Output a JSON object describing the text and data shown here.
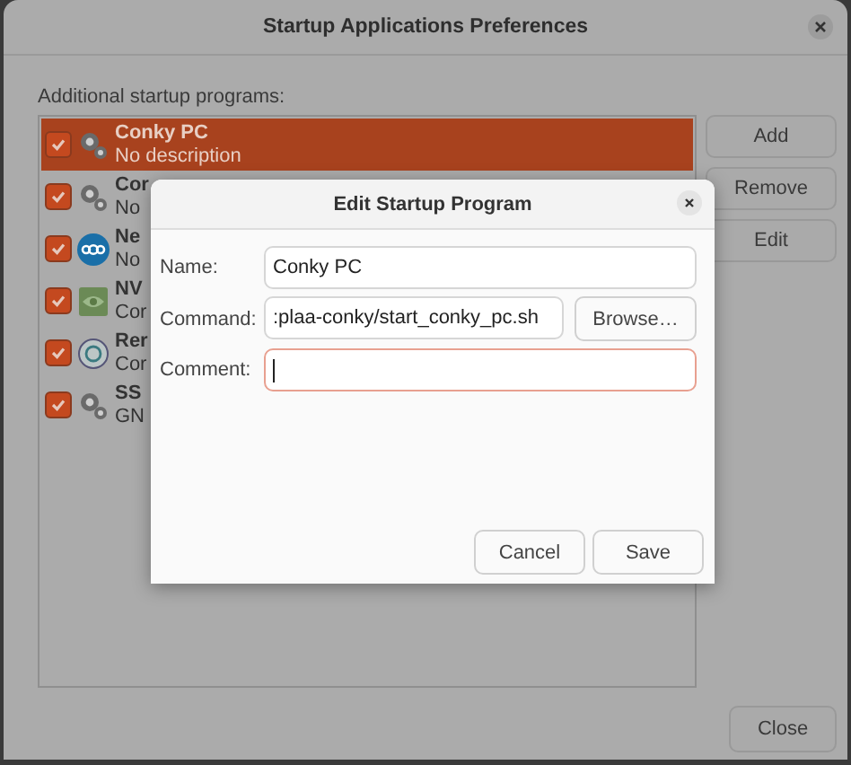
{
  "window": {
    "title": "Startup Applications Preferences"
  },
  "list_label": "Additional startup programs:",
  "programs": [
    {
      "name": "Conky PC",
      "description": "No description",
      "checked": true,
      "selected": true,
      "kind": "gears"
    },
    {
      "name": "Cor",
      "description": "No",
      "checked": true,
      "selected": false,
      "kind": "gears"
    },
    {
      "name": "Ne",
      "description": "No",
      "checked": true,
      "selected": false,
      "kind": "cloud"
    },
    {
      "name": "NV",
      "description": "Cor",
      "checked": true,
      "selected": false,
      "kind": "chip"
    },
    {
      "name": "Rer",
      "description": "Cor",
      "checked": true,
      "selected": false,
      "kind": "ring"
    },
    {
      "name": "SS",
      "description": "GN",
      "checked": true,
      "selected": false,
      "kind": "gears"
    }
  ],
  "side_buttons": [
    "Add",
    "Remove",
    "Edit"
  ],
  "close_button": "Close",
  "dialog": {
    "title": "Edit Startup Program",
    "fields": [
      {
        "label": "Name:",
        "value": "Conky PC",
        "focused": false
      },
      {
        "label": "Command:",
        "value": ":plaa-conky/start_conky_pc.sh",
        "focused": false,
        "button": "Browse…"
      },
      {
        "label": "Comment:",
        "focused": true
      }
    ],
    "buttons": [
      "Cancel",
      "Save"
    ]
  }
}
